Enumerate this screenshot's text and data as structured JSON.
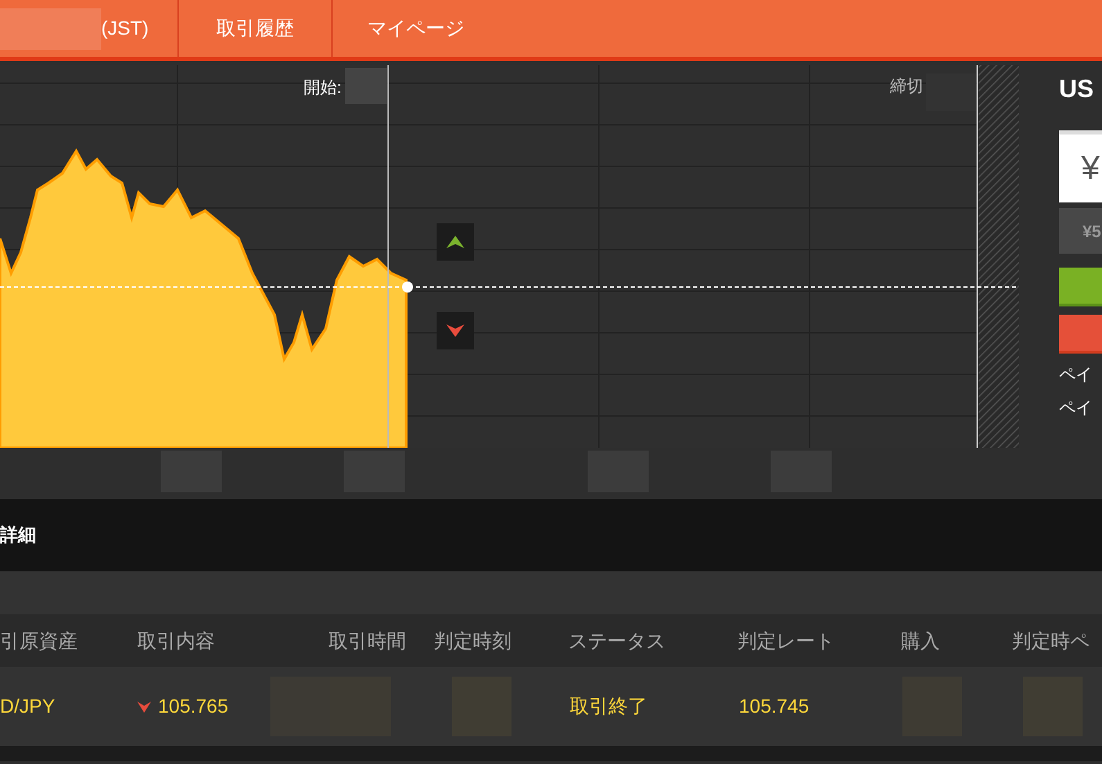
{
  "header": {
    "clock_suffix": "(JST)",
    "links": [
      "取引履歴",
      "マイページ"
    ]
  },
  "chart": {
    "start_label": "開始:",
    "end_label": "締切"
  },
  "order_panel": {
    "title": "US",
    "price": "¥",
    "amount": "¥5",
    "payout_lines": [
      "ペイ",
      "ペイ"
    ]
  },
  "details": {
    "title": "詳細",
    "columns": [
      "引原資産",
      "取引内容",
      "取引時間",
      "判定時刻",
      "ステータス",
      "判定レート",
      "購入",
      "判定時ペ"
    ],
    "rows": [
      {
        "asset": "D/JPY",
        "kind": "down",
        "entry_rate": "105.765",
        "status": "取引終了",
        "judged_rate": "105.745"
      }
    ]
  }
}
